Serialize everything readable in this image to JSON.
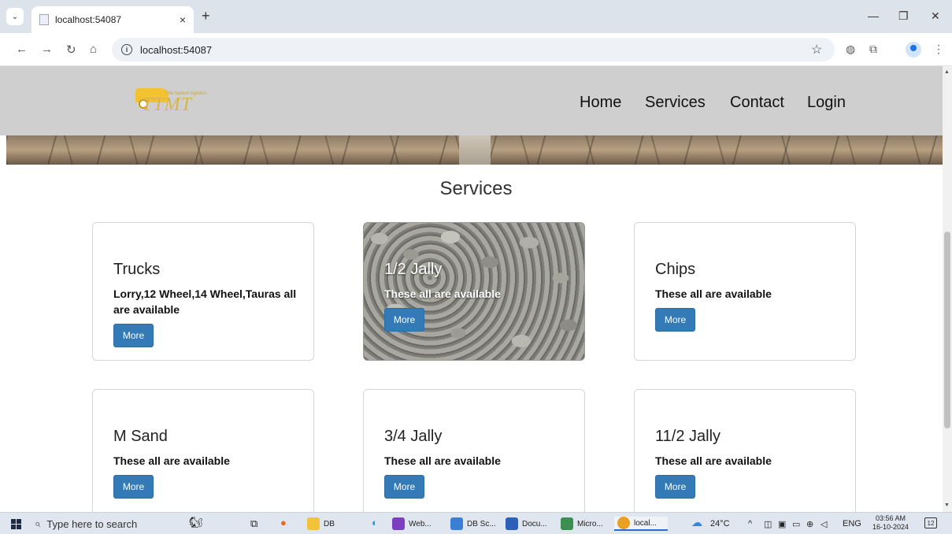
{
  "browser": {
    "tab_title": "localhost:54087",
    "url": "localhost:54087",
    "tab_close": "×",
    "new_tab": "+",
    "minimize": "—",
    "restore": "❐",
    "close": "✕"
  },
  "site": {
    "logo_text": "TTMT",
    "logo_tagline": "The fastest logistics",
    "nav": [
      "Home",
      "Services",
      "Contact",
      "Login"
    ],
    "section_title": "Services",
    "cards": [
      {
        "name": "Trucks",
        "desc": "Lorry,12 Wheel,14 Wheel,Tauras all are available",
        "button": "More"
      },
      {
        "name": "1/2 Jally",
        "desc": "These all are available",
        "button": "More"
      },
      {
        "name": "Chips",
        "desc": "These all are available",
        "button": "More"
      },
      {
        "name": "M Sand",
        "desc": "These all are available",
        "button": "More"
      },
      {
        "name": "3/4 Jally",
        "desc": "These all are available",
        "button": "More"
      },
      {
        "name": "11/2 Jally",
        "desc": "These all are available",
        "button": "More"
      }
    ]
  },
  "taskbar": {
    "search_placeholder": "Type here to search",
    "items": [
      {
        "label": "DB",
        "color": "#f3c13a"
      },
      {
        "label": "Web...",
        "color": "#7b3fbf"
      },
      {
        "label": "DB Sc...",
        "color": "#3b7fd4"
      },
      {
        "label": "Docu...",
        "color": "#2b5fb8"
      },
      {
        "label": "Micro...",
        "color": "#3c8f4f"
      },
      {
        "label": "local...",
        "color": "#e8a020"
      }
    ],
    "weather": "24°C",
    "lang": "ENG",
    "time": "03:56 AM",
    "date": "16-10-2024",
    "notifications": "12"
  }
}
